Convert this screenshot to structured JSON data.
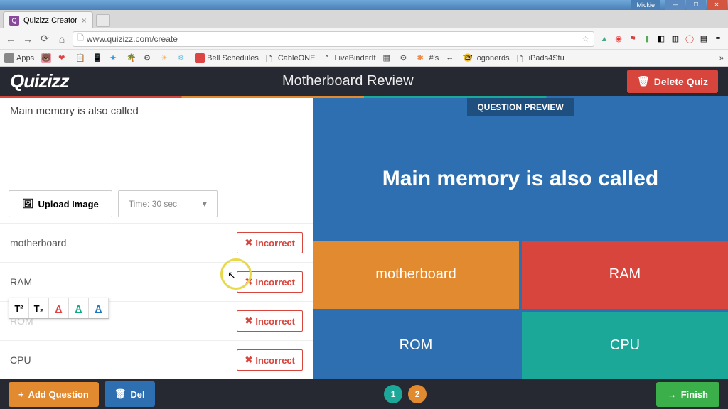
{
  "window": {
    "user": "Mickie"
  },
  "browser": {
    "tab": "Quizizz Creator",
    "url": "www.quizizz.com/create",
    "bookmarks": [
      "Apps",
      "Bell Schedules",
      "CableONE",
      "LiveBinderIt",
      "#'s",
      "logonerds",
      "iPads4Stu"
    ]
  },
  "header": {
    "logo": "Quizizz",
    "quiz_title": "Motherboard Review",
    "delete_label": "Delete Quiz"
  },
  "editor": {
    "question_text": "Main memory is also called",
    "upload_label": "Upload Image",
    "time_label": "Time: 30 sec",
    "answers": [
      {
        "text": "motherboard",
        "status": "Incorrect"
      },
      {
        "text": "RAM",
        "status": "Incorrect"
      },
      {
        "text": "ROM",
        "status": "Incorrect"
      },
      {
        "text": "CPU",
        "status": "Incorrect"
      }
    ]
  },
  "preview": {
    "label": "QUESTION PREVIEW",
    "question": "Main memory is also called",
    "tiles": [
      "motherboard",
      "RAM",
      "ROM",
      "CPU"
    ],
    "colors": [
      "#e18a2f",
      "#d8453c",
      "#2d6fb0",
      "#1ba899"
    ]
  },
  "footer": {
    "add_label": "Add Question",
    "del_label": "Del",
    "finish_label": "Finish",
    "nums": [
      "1",
      "2"
    ]
  }
}
